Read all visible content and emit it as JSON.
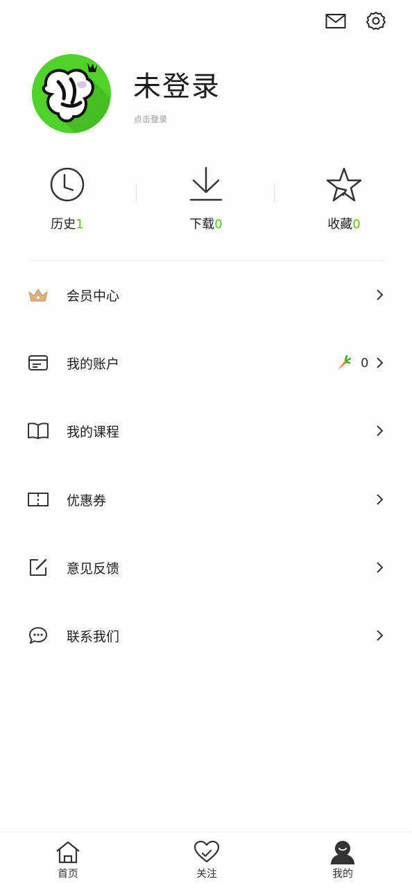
{
  "header": {
    "mail_icon": "mail-icon",
    "settings_icon": "gear-icon"
  },
  "profile": {
    "username": "未登录",
    "login_hint": "点击登录",
    "avatar_color": "#4fd32b"
  },
  "stats": [
    {
      "label": "历史",
      "count": "1",
      "icon": "clock-icon"
    },
    {
      "label": "下载",
      "count": "0",
      "icon": "download-icon"
    },
    {
      "label": "收藏",
      "count": "0",
      "icon": "star-icon"
    }
  ],
  "accent_color": "#5cbd1f",
  "menu": [
    {
      "label": "会员中心",
      "icon": "crown-icon"
    },
    {
      "label": "我的账户",
      "icon": "card-icon",
      "balance": "0",
      "balance_icon": "carrot-icon"
    },
    {
      "label": "我的课程",
      "icon": "book-icon"
    },
    {
      "label": "优惠券",
      "icon": "ticket-icon"
    },
    {
      "label": "意见反馈",
      "icon": "edit-icon"
    },
    {
      "label": "联系我们",
      "icon": "chat-icon"
    }
  ],
  "tabbar": [
    {
      "label": "首页",
      "icon": "home-icon"
    },
    {
      "label": "关注",
      "icon": "heart-check-icon"
    },
    {
      "label": "我的",
      "icon": "user-icon",
      "active": true
    }
  ]
}
